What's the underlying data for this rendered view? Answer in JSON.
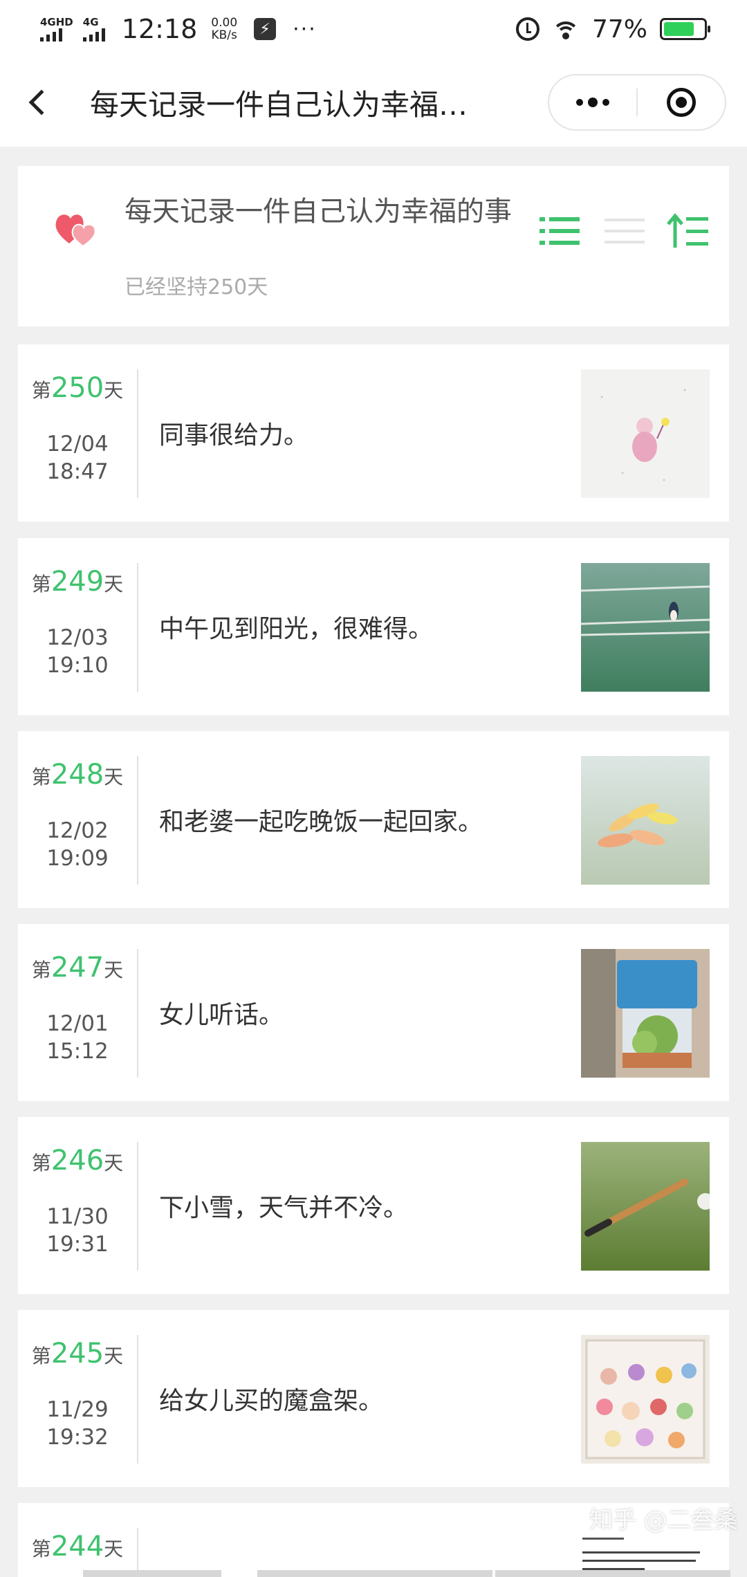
{
  "status_bar": {
    "sim1_label": "4GHD",
    "sim2_label": "4G",
    "time": "12:18",
    "speed_value": "0.00",
    "speed_unit": "KB/s",
    "more": "···",
    "battery_text": "77%",
    "battery_level": 0.77,
    "battery_color": "#2fd05a"
  },
  "nav": {
    "title": "每天记录一件自己认为幸福…",
    "icons": [
      "back-arrow-icon",
      "more-dots-icon",
      "close-target-icon"
    ]
  },
  "header": {
    "title": "每天记录一件自己认为幸福的事",
    "subtitle": "已经坚持250天",
    "icons": [
      "heart-icon",
      "list-view-icon",
      "compact-list-icon",
      "sort-order-icon"
    ],
    "accent_color": "#3fc26e"
  },
  "entries": [
    {
      "prefix": "第",
      "day": "250",
      "suffix": "天",
      "date": "12/04",
      "time": "18:47",
      "text": "同事很给力。",
      "thumb": "pink-doll-drawing-image"
    },
    {
      "prefix": "第",
      "day": "249",
      "suffix": "天",
      "date": "12/03",
      "time": "19:10",
      "text": "中午见到阳光，很难得。",
      "thumb": "swallow-on-wire-image"
    },
    {
      "prefix": "第",
      "day": "248",
      "suffix": "天",
      "date": "12/02",
      "time": "19:09",
      "text": "和老婆一起吃晚饭一起回家。",
      "thumb": "yellow-leaf-image"
    },
    {
      "prefix": "第",
      "day": "247",
      "suffix": "天",
      "date": "12/01",
      "time": "15:12",
      "text": "女儿听话。",
      "thumb": "potted-plant-image"
    },
    {
      "prefix": "第",
      "day": "246",
      "suffix": "天",
      "date": "11/30",
      "time": "19:31",
      "text": "下小雪，天气并不冷。",
      "thumb": "bat-on-grass-image"
    },
    {
      "prefix": "第",
      "day": "245",
      "suffix": "天",
      "date": "11/29",
      "time": "19:32",
      "text": "给女儿买的魔盒架。",
      "thumb": "toy-figures-shelf-image"
    },
    {
      "prefix": "第",
      "day": "244",
      "suffix": "天",
      "date": "",
      "time": "",
      "text": "",
      "thumb": "document-text-image"
    }
  ],
  "watermark": "知乎 @二叁桑"
}
